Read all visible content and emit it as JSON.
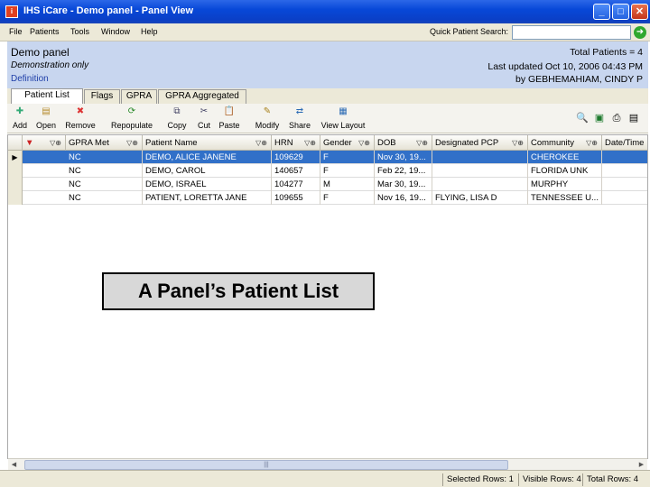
{
  "window": {
    "title": "IHS iCare - Demo panel - Panel View",
    "buttons": {
      "minimize": "_",
      "maximize": "□",
      "close": "✕"
    }
  },
  "menu": {
    "items": [
      "File",
      "Patients",
      "Tools",
      "Window",
      "Help"
    ],
    "quick_search_label": "Quick Patient Search:",
    "quick_search_value": ""
  },
  "header": {
    "panel_name": "Demo panel",
    "description": "Demonstration only",
    "definition_link": "Definition",
    "total_patients": "Total Patients = 4",
    "last_updated": "Last updated Oct 10, 2006 04:43 PM",
    "updated_by": "by GEBHEMAHIAM, CINDY P"
  },
  "tabs": [
    "Patient List",
    "Flags",
    "GPRA",
    "GPRA Aggregated"
  ],
  "toolbar": {
    "buttons": [
      "Add",
      "Open",
      "Remove",
      "Repopulate",
      "Copy",
      "Cut",
      "Paste",
      "Modify",
      "Share",
      "View Layout"
    ]
  },
  "grid": {
    "columns": [
      "GPRA Met",
      "Patient Name",
      "HRN",
      "Gender",
      "DOB",
      "Designated PCP",
      "Community",
      "Date/Time"
    ],
    "rows": [
      [
        "NC",
        "DEMO, ALICE JANENE",
        "109629",
        "F",
        "Nov 30, 19...",
        "",
        "CHEROKEE",
        ""
      ],
      [
        "NC",
        "DEMO, CAROL",
        "140657",
        "F",
        "Feb 22, 19...",
        "",
        "FLORIDA UNK",
        ""
      ],
      [
        "NC",
        "DEMO, ISRAEL",
        "104277",
        "M",
        "Mar 30, 19...",
        "",
        "MURPHY",
        ""
      ],
      [
        "NC",
        "PATIENT, LORETTA JANE",
        "109655",
        "F",
        "Nov 16, 19...",
        "FLYING, LISA D",
        "TENNESSEE U...",
        ""
      ]
    ],
    "selected_row": 0
  },
  "caption": "A Panel’s Patient List",
  "statusbar": {
    "selected_rows": "Selected Rows: 1",
    "visible_rows": "Visible Rows: 4",
    "total_rows": "Total Rows: 4"
  },
  "colors": {
    "titlebar": "#0a3fc6",
    "header_bg": "#c8d6ef",
    "selection": "#3170c8"
  }
}
